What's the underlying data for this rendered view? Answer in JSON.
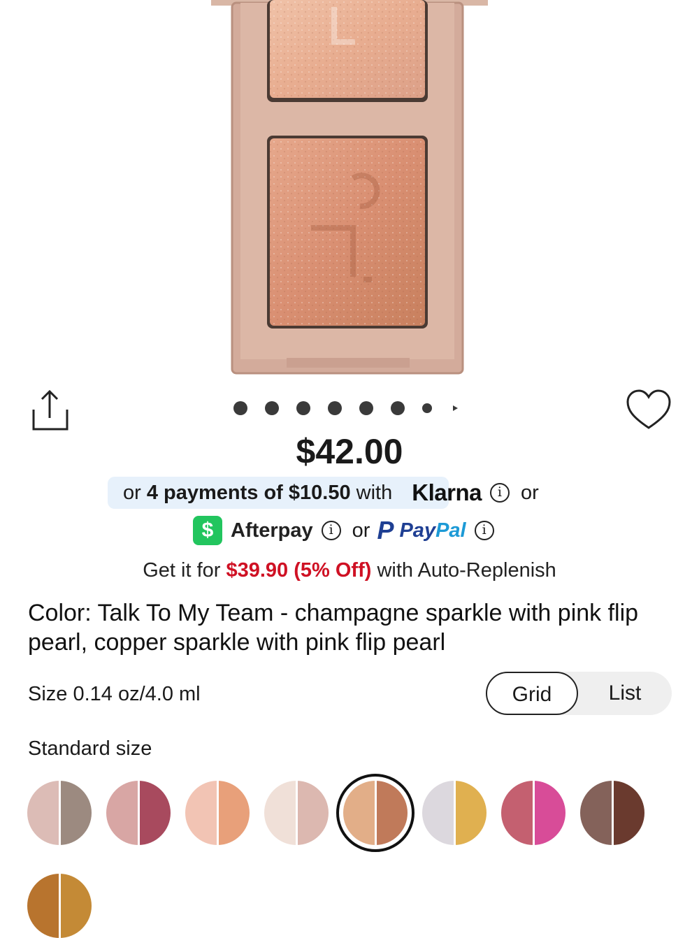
{
  "product": {
    "price": "$42.00",
    "carousel_dot_count": 7,
    "carousel_selected": 1
  },
  "payments": {
    "klarna": {
      "prefix": "or ",
      "bold": "4 payments of $10.50",
      "suffix": " with",
      "brand": "Klarna",
      "after": "or"
    },
    "afterpay": {
      "badge": "$",
      "brand": "Afterpay",
      "after": "or"
    },
    "paypal": {
      "mark": "P",
      "brand_part1": "Pay",
      "brand_part2": "Pal"
    },
    "info_glyph": "i"
  },
  "autoreplenish": {
    "prefix": "Get it for ",
    "highlight": "$39.90 (5% Off)",
    "suffix": " with Auto-Replenish"
  },
  "color": {
    "description": "Color: Talk To My Team - champagne sparkle with pink flip pearl, copper sparkle with pink flip pearl"
  },
  "size": {
    "label": "Size 0.14 oz/4.0 ml",
    "view_options": [
      "Grid",
      "List"
    ],
    "selected_view": "Grid",
    "group_label": "Standard size"
  },
  "swatches": [
    {
      "left": "#dcbcb6",
      "right": "#9c8a80",
      "selected": false
    },
    {
      "left": "#d8a6a4",
      "right": "#a84a5e",
      "selected": false
    },
    {
      "left": "#f2c4b4",
      "right": "#e8a07a",
      "selected": false
    },
    {
      "left": "#f0e0d8",
      "right": "#dcb8b0",
      "selected": false
    },
    {
      "left": "#e2ae88",
      "right": "#c07a5a",
      "selected": true
    },
    {
      "left": "#dcd8de",
      "right": "#e0b050",
      "selected": false
    },
    {
      "left": "#c46070",
      "right": "#d84c98",
      "selected": false
    },
    {
      "left": "#84625a",
      "right": "#6a3a2e",
      "selected": false
    },
    {
      "left": "#b8742e",
      "right": "#c48a36",
      "selected": false
    }
  ],
  "icons": {
    "share": "share-icon",
    "favorite": "heart-icon"
  }
}
